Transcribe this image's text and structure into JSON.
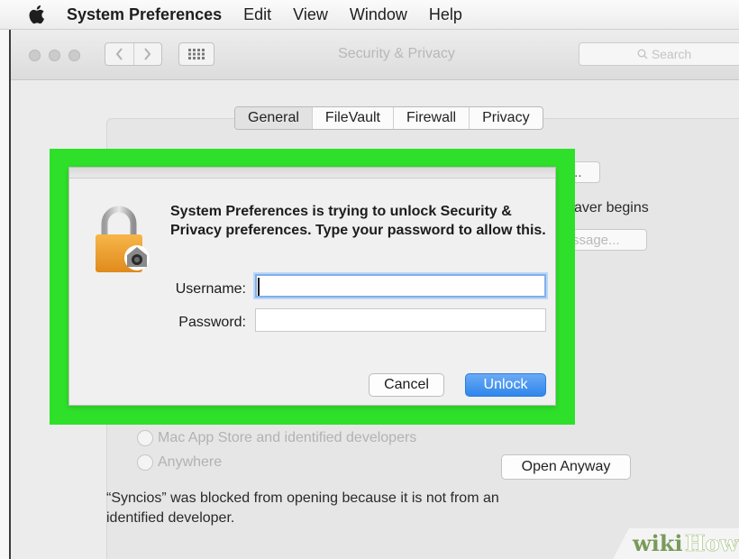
{
  "menubar": {
    "apple_icon": "apple-logo-icon",
    "items": [
      "System Preferences",
      "Edit",
      "View",
      "Window",
      "Help"
    ]
  },
  "window": {
    "title": "Security & Privacy",
    "search_placeholder": "Search",
    "tabs": [
      {
        "label": "General",
        "active": true
      },
      {
        "label": "FileVault",
        "active": false
      },
      {
        "label": "Firewall",
        "active": false
      },
      {
        "label": "Privacy",
        "active": false
      }
    ]
  },
  "background": {
    "button_partial": "...",
    "screensaver_text": "aver begins",
    "set_message_button": "ssage...",
    "radio_mac_app_store": "Mac App Store and identified developers",
    "radio_anywhere": "Anywhere",
    "blocked_message": "“Syncios” was blocked from opening because it is not from an identified developer.",
    "open_anyway_button": "Open Anyway"
  },
  "dialog": {
    "highlight_color": "#2fe02a",
    "icon": "padlock-icon",
    "message": "System Preferences is trying to unlock Security & Privacy preferences. Type your password to allow this.",
    "username_label": "Username:",
    "username_value": "",
    "password_label": "Password:",
    "password_value": "",
    "cancel_button": "Cancel",
    "unlock_button": "Unlock"
  },
  "watermark": {
    "text_wiki": "wiki",
    "text_how": "How"
  }
}
